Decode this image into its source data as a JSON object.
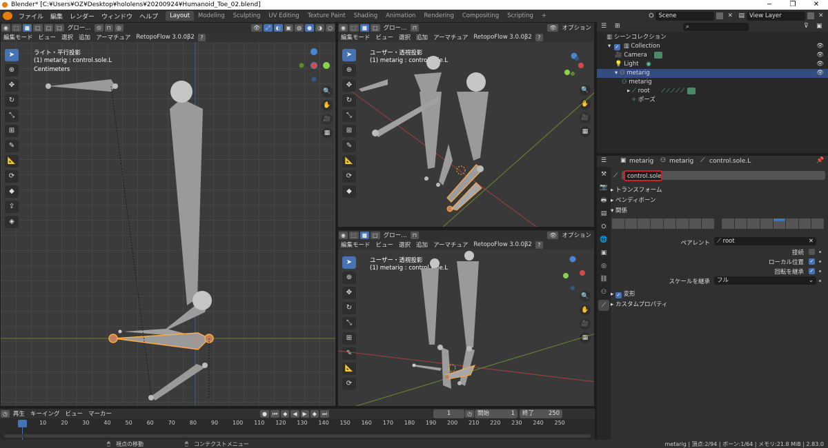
{
  "window": {
    "title": "Blender* [C:¥Users¥OZ¥Desktop¥hololens¥20200924¥Humanoid_Toe_02.blend]",
    "controls": [
      "−",
      "❐",
      "✕"
    ]
  },
  "menu": [
    "ファイル",
    "編集",
    "レンダー",
    "ウィンドウ",
    "ヘルプ"
  ],
  "workspaces": [
    "Layout",
    "Modeling",
    "Sculpting",
    "UV Editing",
    "Texture Paint",
    "Shading",
    "Animation",
    "Rendering",
    "Compositing",
    "Scripting"
  ],
  "active_workspace": "Layout",
  "add_workspace": "+",
  "scene": {
    "name": "Scene",
    "view_layer": "View Layer"
  },
  "viewport_header": {
    "transform_orientation": "グロー…",
    "mode": "編集モード",
    "menus": [
      "ビュー",
      "選択",
      "追加",
      "アーマチュア"
    ],
    "addon": "RetopoFlow 3.0.0β2",
    "options": "オプション"
  },
  "viewports": {
    "left": {
      "view_name": "ライト・平行投影",
      "object": "(1) metarig : control.sole.L",
      "units": "Centimeters"
    },
    "top_right": {
      "view_name": "ユーザー・透視投影",
      "object": "(1) metarig : control.sole.L"
    },
    "bottom_right": {
      "view_name": "ユーザー・透視投影",
      "object": "(1) metarig : control.sole.L"
    }
  },
  "outliner": {
    "header": "シーンコレクション",
    "rows": [
      {
        "label": "Collection"
      },
      {
        "label": "Camera"
      },
      {
        "label": "Light"
      },
      {
        "label": "metarig"
      },
      {
        "label": "metarig"
      },
      {
        "label": "root"
      },
      {
        "label": "ポーズ"
      }
    ],
    "search_placeholder": ""
  },
  "properties": {
    "breadcrumb": [
      "metarig",
      "metarig",
      "control.sole.L"
    ],
    "bone_name": "control.sole.L",
    "sections": {
      "transform": "トランスフォーム",
      "bendy": "ベンディボーン",
      "relations": "関係",
      "deform": "変形",
      "custom": "カスタムプロパティ"
    },
    "parent_label": "ペアレント",
    "parent_value": "root",
    "connected_label": "接続",
    "local_location_label": "ローカル位置",
    "inherit_rotation_label": "回転を継承",
    "inherit_scale_label": "スケールを継承",
    "inherit_scale_value": "フル",
    "connected": false,
    "local_location": true,
    "inherit_rotation": true,
    "deform": true
  },
  "timeline": {
    "menus": [
      "再生",
      "キーイング",
      "ビュー",
      "マーカー"
    ],
    "current_frame": "1",
    "start_label": "開始",
    "start": "1",
    "end_label": "終了",
    "end": "250",
    "ticks": [
      "1",
      "10",
      "20",
      "30",
      "40",
      "50",
      "60",
      "70",
      "80",
      "90",
      "100",
      "110",
      "120",
      "130",
      "140",
      "150",
      "160",
      "170",
      "180",
      "190",
      "200",
      "210",
      "220",
      "230",
      "240",
      "250"
    ]
  },
  "statusbar": {
    "left_hint": "視点の移動",
    "mid_hint": "コンテクストメニュー",
    "stats": "metarig | 頂点:2/94 | ボーン:1/64 | メモリ:21.8 MiB | 2.83.0"
  },
  "colors": {
    "accent": "#4772b3",
    "bone_selected": "#ffaa40",
    "axis_x": "#d34a4a",
    "axis_y": "#8bd44a",
    "axis_z": "#4a86d4"
  }
}
